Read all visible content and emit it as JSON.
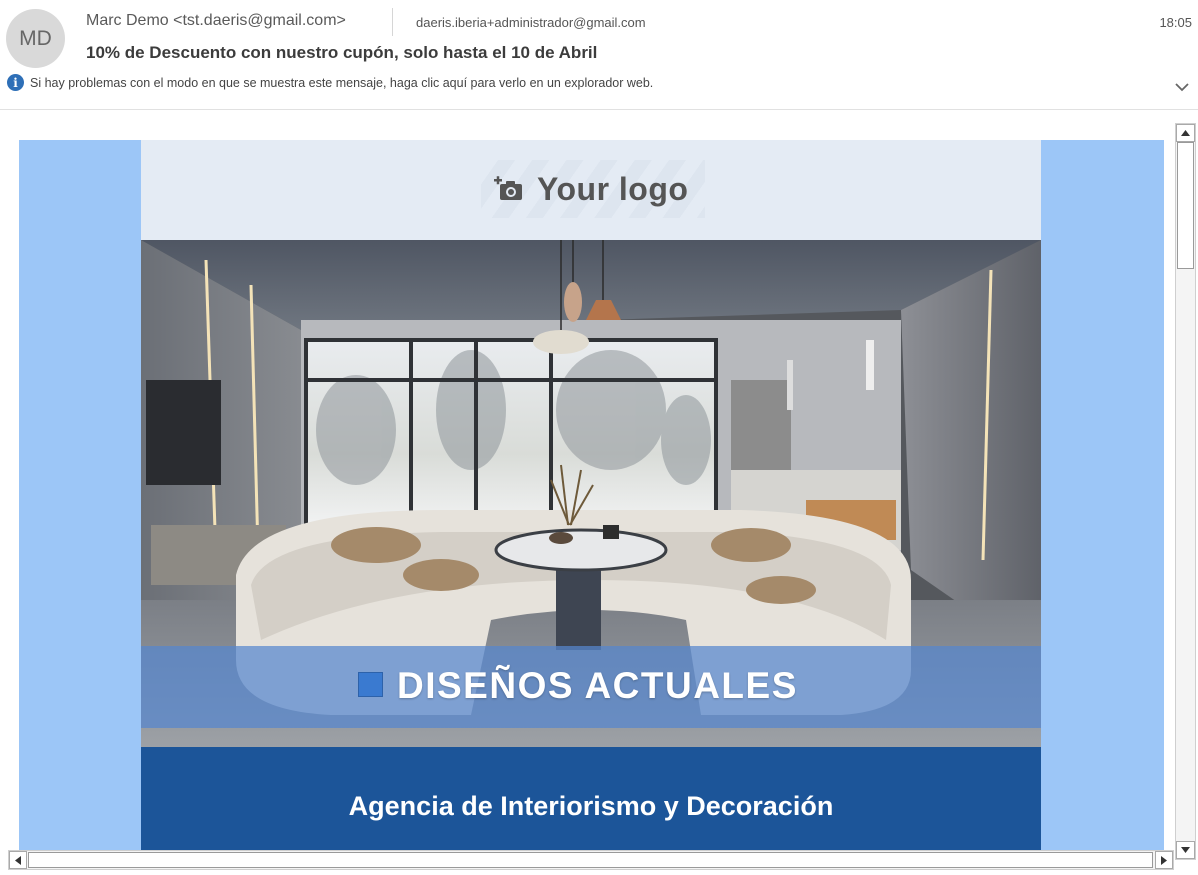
{
  "header": {
    "avatar_initials": "MD",
    "sender": "Marc Demo <tst.daeris@gmail.com>",
    "recipient": "daeris.iberia+administrador@gmail.com",
    "time": "18:05",
    "subject": "10% de Descuento con nuestro cupón, solo hasta el 10 de Abril",
    "info_message": "Si hay problemas con el modo en que se muestra este mensaje, haga clic aquí para verlo en un explorador web.",
    "info_icon": "info-icon",
    "expand_icon": "chevron-down-icon"
  },
  "email": {
    "logo_text": "Your logo",
    "logo_icon": "camera-plus-icon",
    "hero_title": "DISEÑOS ACTUALES",
    "agency_title": "Agencia de Interiorismo y Decoración",
    "colors": {
      "outer_background": "#9cc6f7",
      "logo_background": "#e4ebf4",
      "hero_band": "#5687ce",
      "agency_bar": "#1c5599"
    }
  },
  "scrollbars": {
    "vertical_icons": [
      "arrow-up-icon",
      "arrow-down-icon"
    ],
    "horizontal_icons": [
      "arrow-left-icon",
      "arrow-right-icon"
    ]
  }
}
